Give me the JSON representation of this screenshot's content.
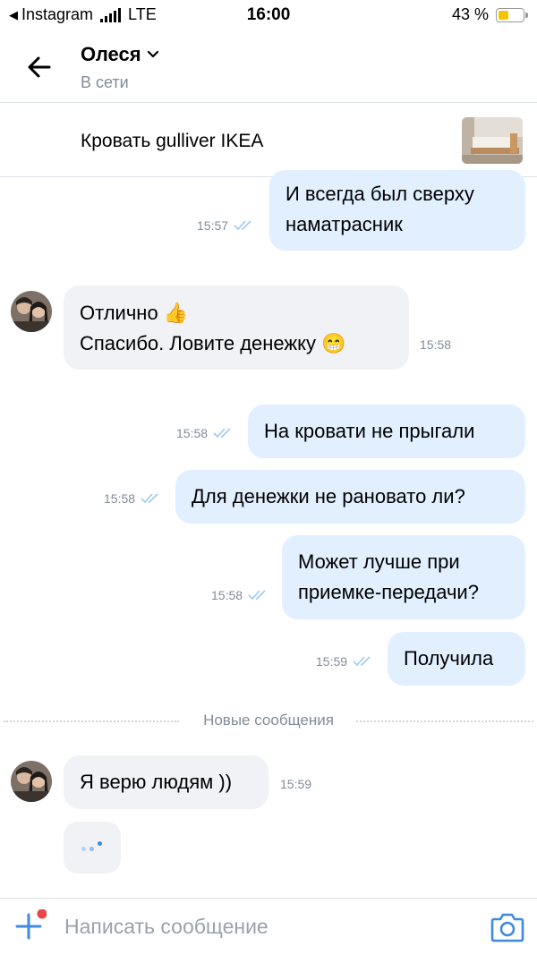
{
  "status_bar": {
    "carrier": "Instagram",
    "network": "LTE",
    "time": "16:00",
    "battery": "43 %",
    "battery_level": 0.43,
    "battery_color": "#f5c400"
  },
  "header": {
    "contact_name": "Олеся",
    "presence": "В сети",
    "back_icon": "arrow-left-icon",
    "chevron_icon": "chevron-down-icon"
  },
  "pinned_item": {
    "title": "Кровать gulliver IKEA",
    "thumbnail": "bed-photo"
  },
  "messages": [
    {
      "direction": "out",
      "lines": [
        "И всегда был сверху",
        "наматрасник"
      ],
      "time": "15:57",
      "read": true
    },
    {
      "direction": "in",
      "lines": [
        "Отлично 👍",
        "Спасибо. Ловите денежку 😁"
      ],
      "time": "15:58"
    },
    {
      "direction": "out",
      "lines": [
        "На кровати не прыгали"
      ],
      "time": "15:58",
      "read": true
    },
    {
      "direction": "out",
      "lines": [
        "Для денежки не рановато ли?"
      ],
      "time": "15:58",
      "read": true
    },
    {
      "direction": "out",
      "lines": [
        "Может лучше при",
        "приемке-передачи?"
      ],
      "time": "15:58",
      "read": true
    },
    {
      "direction": "out",
      "lines": [
        "Получила"
      ],
      "time": "15:59",
      "read": true
    },
    {
      "direction": "in",
      "lines": [
        "Я верю людям ))"
      ],
      "time": "15:59"
    }
  ],
  "new_messages_label": "Новые сообщения",
  "composer": {
    "placeholder": "Написать сообщение",
    "attach_icon": "plus-icon",
    "camera_icon": "camera-icon"
  },
  "colors": {
    "outgoing_bubble": "#e1efff",
    "incoming_bubble": "#f0f2f5",
    "accent": "#3f8ae0",
    "meta_text": "#818c99",
    "notification_dot": "#e64646"
  }
}
